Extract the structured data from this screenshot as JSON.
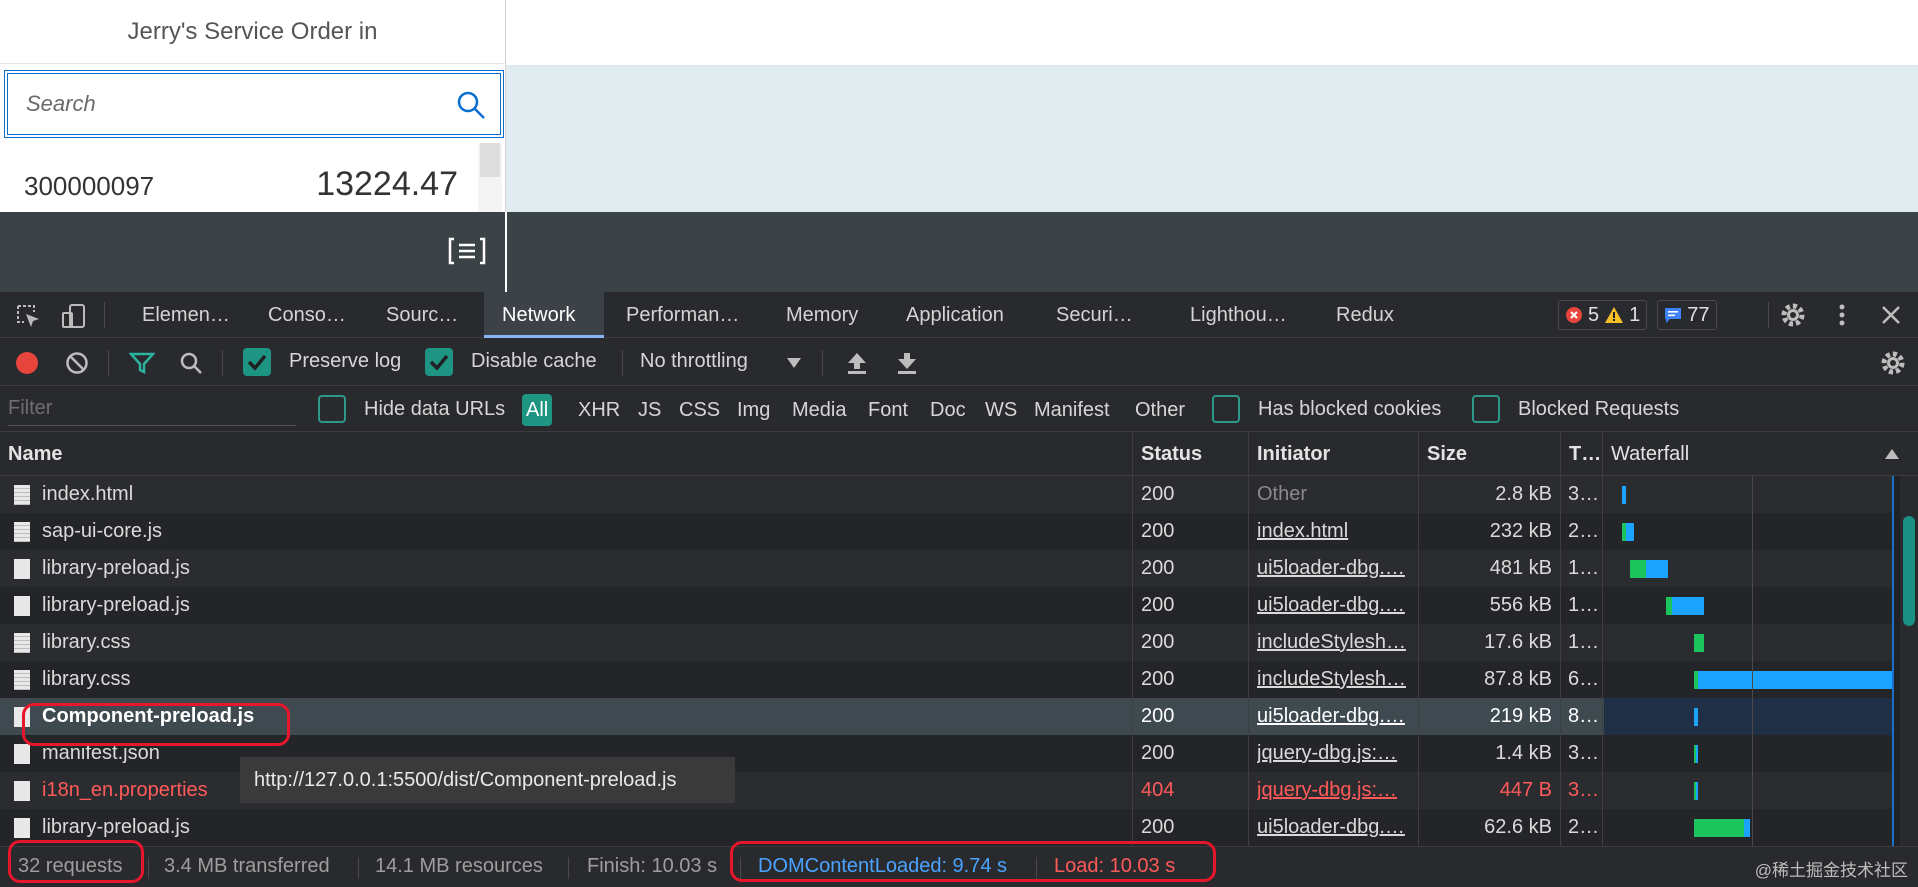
{
  "app": {
    "title": "Jerry's Service Order in",
    "search": {
      "placeholder": "Search",
      "value": ""
    },
    "list": [
      {
        "id": "300000097",
        "amount": "13224.47"
      }
    ]
  },
  "devtools": {
    "tabs": [
      {
        "label": "Elemen…"
      },
      {
        "label": "Conso…"
      },
      {
        "label": "Sourc…"
      },
      {
        "label": "Network",
        "active": true
      },
      {
        "label": "Performan…"
      },
      {
        "label": "Memory"
      },
      {
        "label": "Application"
      },
      {
        "label": "Securi…"
      },
      {
        "label": "Lighthou…"
      },
      {
        "label": "Redux"
      }
    ],
    "badges": {
      "errors": "5",
      "warnings": "1",
      "messages": "77"
    },
    "toolbar": {
      "preserve_log": "Preserve log",
      "disable_cache": "Disable cache",
      "throttling": "No throttling"
    },
    "filter": {
      "placeholder": "Filter",
      "hide_data_urls": "Hide data URLs",
      "types": [
        "All",
        "XHR",
        "JS",
        "CSS",
        "Img",
        "Media",
        "Font",
        "Doc",
        "WS",
        "Manifest",
        "Other"
      ],
      "has_blocked_cookies": "Has blocked cookies",
      "blocked_requests": "Blocked Requests"
    },
    "columns": {
      "name": "Name",
      "status": "Status",
      "initiator": "Initiator",
      "size": "Size",
      "time": "T…",
      "waterfall": "Waterfall"
    },
    "rows": [
      {
        "name": "index.html",
        "status": "200",
        "initiator": "Other",
        "size": "2.8 kB",
        "time": "3…"
      },
      {
        "name": "sap-ui-core.js",
        "status": "200",
        "initiator": "index.html",
        "size": "232 kB",
        "time": "2…"
      },
      {
        "name": "library-preload.js",
        "status": "200",
        "initiator": "ui5loader-dbg.…",
        "size": "481 kB",
        "time": "1…"
      },
      {
        "name": "library-preload.js",
        "status": "200",
        "initiator": "ui5loader-dbg.…",
        "size": "556 kB",
        "time": "1…"
      },
      {
        "name": "library.css",
        "status": "200",
        "initiator": "includeStylesh…",
        "size": "17.6 kB",
        "time": "1…"
      },
      {
        "name": "library.css",
        "status": "200",
        "initiator": "includeStylesh…",
        "size": "87.8 kB",
        "time": "6…"
      },
      {
        "name": "Component-preload.js",
        "status": "200",
        "initiator": "ui5loader-dbg.…",
        "size": "219 kB",
        "time": "8…"
      },
      {
        "name": "manifest.json",
        "status": "200",
        "initiator": "jquery-dbg.js:…",
        "size": "1.4 kB",
        "time": "3…"
      },
      {
        "name": "i18n_en.properties",
        "status": "404",
        "initiator": "jquery-dbg.js:…",
        "size": "447 B",
        "time": "3…"
      },
      {
        "name": "library-preload.js",
        "status": "200",
        "initiator": "ui5loader-dbg.…",
        "size": "62.6 kB",
        "time": "2…"
      }
    ],
    "tooltip": "http://127.0.0.1:5500/dist/Component-preload.js",
    "status_bar": {
      "requests": "32 requests",
      "transferred": "3.4 MB transferred",
      "resources": "14.1 MB resources",
      "finish": "Finish: 10.03 s",
      "dom_content_loaded": "DOMContentLoaded: 9.74 s",
      "load": "Load: 10.03 s"
    }
  },
  "watermark": "@稀土掘金技术社区",
  "colors": {
    "accent_teal": "#1e9483",
    "error_red": "#e6162b",
    "dcl_blue": "#4aa3ff",
    "load_red": "#ff5a5a",
    "waterfall_green": "#1bc45d",
    "waterfall_blue": "#1aa3ff"
  }
}
